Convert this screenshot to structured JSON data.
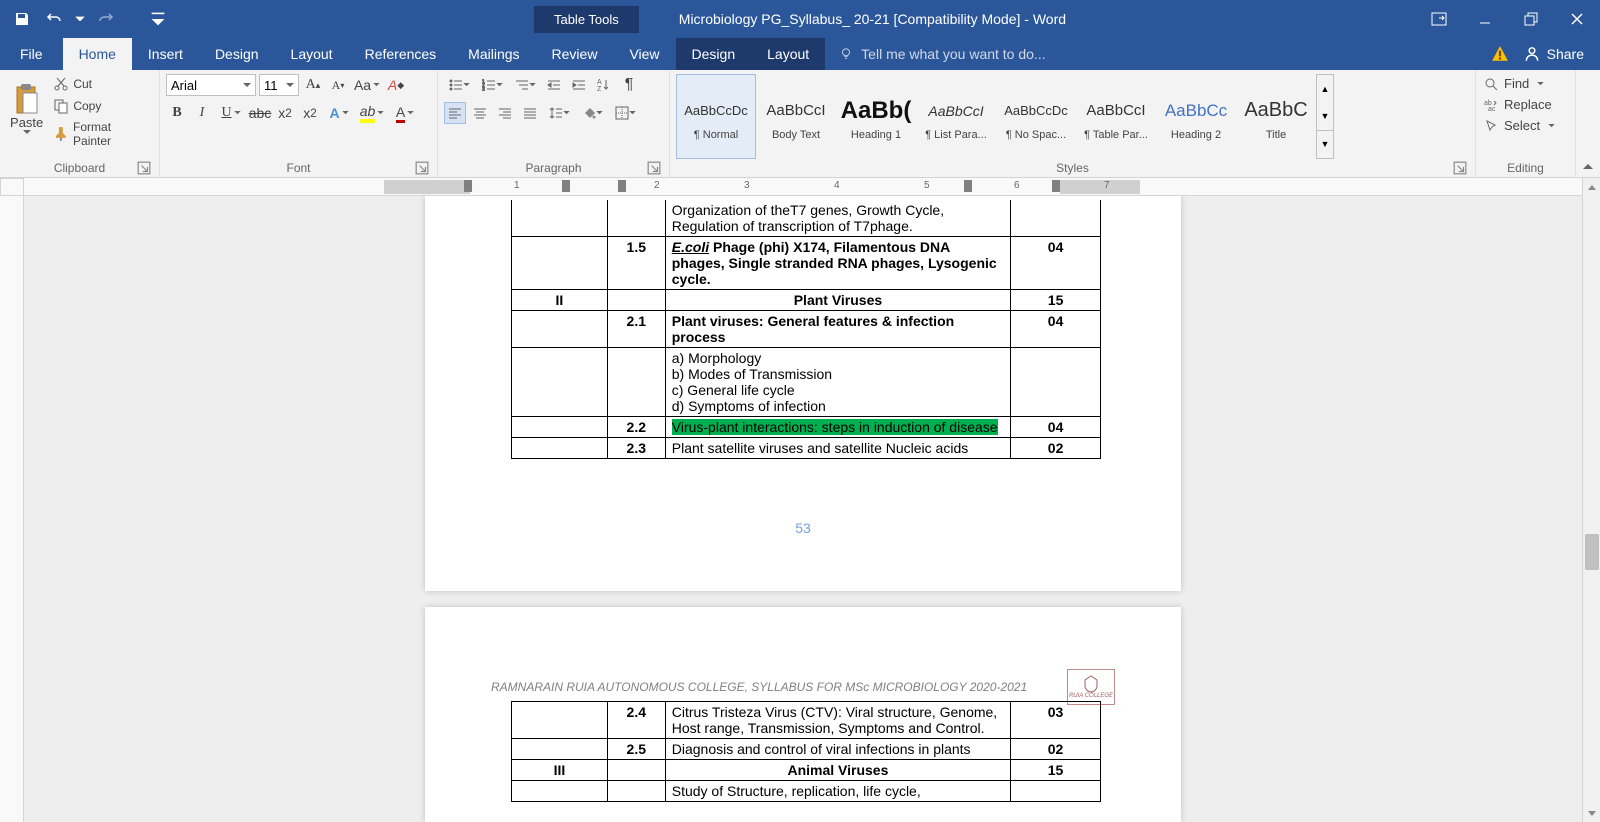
{
  "title_bar": {
    "table_tools": "Table Tools",
    "doc_title": "Microbiology PG_Syllabus_ 20-21 [Compatibility Mode] - Word"
  },
  "menu": {
    "file": "File",
    "home": "Home",
    "insert": "Insert",
    "design": "Design",
    "layout": "Layout",
    "references": "References",
    "mailings": "Mailings",
    "review": "Review",
    "view": "View",
    "design2": "Design",
    "layout2": "Layout",
    "tell_me": "Tell me what you want to do...",
    "share": "Share"
  },
  "ribbon": {
    "clipboard": {
      "label": "Clipboard",
      "paste": "Paste",
      "cut": "Cut",
      "copy": "Copy",
      "format_painter": "Format Painter"
    },
    "font": {
      "label": "Font",
      "name": "Arial",
      "size": "11"
    },
    "paragraph": {
      "label": "Paragraph"
    },
    "styles": {
      "label": "Styles",
      "items": [
        {
          "preview": "AaBbCcDc",
          "name": "¶ Normal",
          "size": "13px",
          "color": "#333"
        },
        {
          "preview": "AaBbCcI",
          "name": "Body Text",
          "size": "15px",
          "color": "#333"
        },
        {
          "preview": "AaBb(",
          "name": "Heading 1",
          "size": "24px",
          "color": "#111",
          "bold": true
        },
        {
          "preview": "AaBbCcI",
          "name": "¶ List Para...",
          "size": "14px",
          "color": "#333",
          "italic": true
        },
        {
          "preview": "AaBbCcDc",
          "name": "¶ No Spac...",
          "size": "13px",
          "color": "#333"
        },
        {
          "preview": "AaBbCcI",
          "name": "¶ Table Par...",
          "size": "15px",
          "color": "#333"
        },
        {
          "preview": "AaBbCc",
          "name": "Heading 2",
          "size": "17px",
          "color": "#4472c4"
        },
        {
          "preview": "AaBbC",
          "name": "Title",
          "size": "20px",
          "color": "#333"
        }
      ]
    },
    "editing": {
      "label": "Editing",
      "find": "Find",
      "replace": "Replace",
      "select": "Select"
    }
  },
  "document": {
    "page_number": "53",
    "header_text": "RAMNARAIN RUIA AUTONOMOUS COLLEGE, SYLLABUS FOR MSc MICROBIOLOGY 2020-2021",
    "logo_text": "RUIA COLLEGE",
    "table_rows": [
      {
        "a": "",
        "b": "",
        "c": "Organization of theT7 genes, Growth Cycle, Regulation of transcription of T7phage.",
        "d": ""
      },
      {
        "a": "",
        "b": "1.5",
        "c_pre": "E.coli",
        "c_post": " Phage (phi) X174, Filamentous DNA phages, Single stranded RNA phages, Lysogenic cycle.",
        "d": "04",
        "bold": true,
        "italic_pre": true
      },
      {
        "a": "II",
        "b": "",
        "c": "Plant Viruses",
        "d": "15",
        "section": true
      },
      {
        "a": "",
        "b": "2.1",
        "c": "Plant viruses: General features & infection process",
        "d": "04",
        "bold": true
      },
      {
        "a": "",
        "b": "",
        "c_list": [
          "a)   Morphology",
          "b)   Modes of Transmission",
          "c)   General life cycle",
          "d)   Symptoms of infection"
        ],
        "d": ""
      },
      {
        "a": "",
        "b": "2.2",
        "c": "Virus-plant interactions: steps in induction of disease",
        "d": "04",
        "highlight": true
      },
      {
        "a": "",
        "b": "2.3",
        "c": "Plant satellite viruses and satellite Nucleic acids",
        "d": "02"
      }
    ],
    "table2_rows": [
      {
        "a": "",
        "b": "2.4",
        "c": "Citrus Tristeza Virus (CTV): Viral structure, Genome, Host range, Transmission, Symptoms and Control.",
        "d": "03"
      },
      {
        "a": "",
        "b": "2.5",
        "c": "Diagnosis and control of viral infections in plants",
        "d": "02"
      },
      {
        "a": "III",
        "b": "",
        "c": "Animal Viruses",
        "d": "15",
        "section": true
      },
      {
        "a": "",
        "b": "",
        "c": "Study of Structure, replication, life cycle,",
        "d": ""
      }
    ]
  }
}
